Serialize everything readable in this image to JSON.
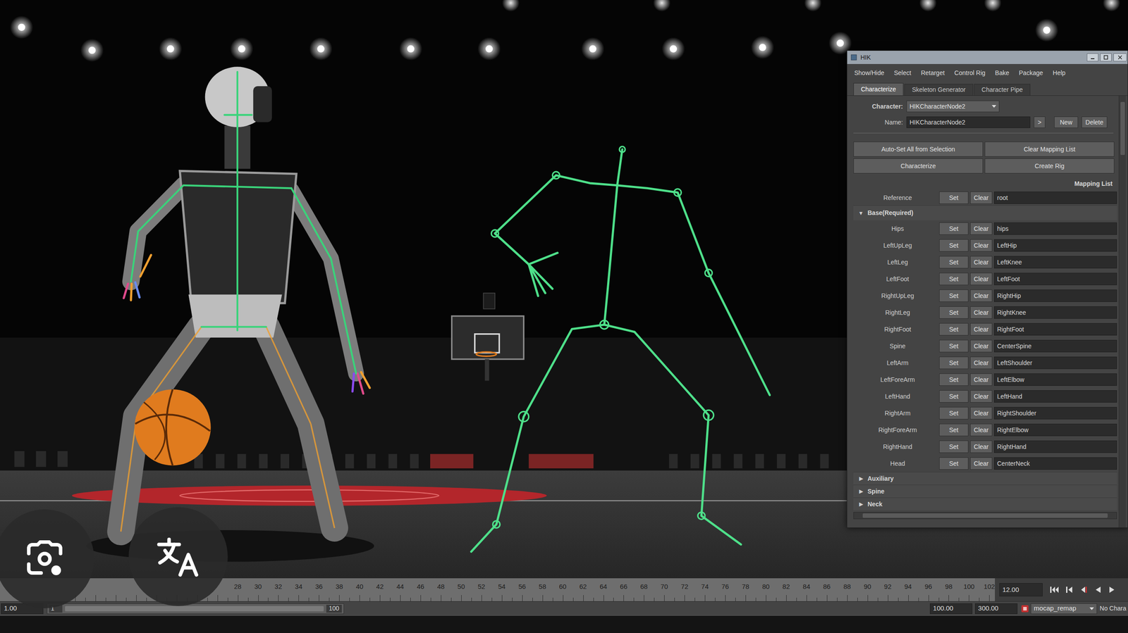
{
  "hik": {
    "title": "HIK",
    "menu": [
      "Show/Hide",
      "Select",
      "Retarget",
      "Control Rig",
      "Bake",
      "Package",
      "Help"
    ],
    "tabs": [
      {
        "label": "Characterize",
        "selected": true
      },
      {
        "label": "Skeleton Generator",
        "selected": false
      },
      {
        "label": "Character Pipe",
        "selected": false
      }
    ],
    "character": {
      "label": "Character:",
      "value": "HIKCharacterNode2"
    },
    "name": {
      "label": "Name:",
      "value": "HIKCharacterNode2",
      "arrow": ">",
      "new": "New",
      "delete": "Delete"
    },
    "actions": [
      "Auto-Set All from Selection",
      "Clear Mapping List",
      "Characterize",
      "Create Rig"
    ],
    "mapping_label": "Mapping List",
    "reference": {
      "label": "Reference",
      "set": "Set",
      "clear": "Clear",
      "value": "root"
    },
    "sections": [
      {
        "icon": "▼",
        "label": "Base(Required)",
        "expanded": true,
        "rows": [
          {
            "label": "Hips",
            "set": "Set",
            "clear": "Clear",
            "value": "hips"
          },
          {
            "label": "LeftUpLeg",
            "set": "Set",
            "clear": "Clear",
            "value": "LeftHip"
          },
          {
            "label": "LeftLeg",
            "set": "Set",
            "clear": "Clear",
            "value": "LeftKnee"
          },
          {
            "label": "LeftFoot",
            "set": "Set",
            "clear": "Clear",
            "value": "LeftFoot"
          },
          {
            "label": "RightUpLeg",
            "set": "Set",
            "clear": "Clear",
            "value": "RightHip"
          },
          {
            "label": "RightLeg",
            "set": "Set",
            "clear": "Clear",
            "value": "RightKnee"
          },
          {
            "label": "RightFoot",
            "set": "Set",
            "clear": "Clear",
            "value": "RightFoot"
          },
          {
            "label": "Spine",
            "set": "Set",
            "clear": "Clear",
            "value": "CenterSpine"
          },
          {
            "label": "LeftArm",
            "set": "Set",
            "clear": "Clear",
            "value": "LeftShoulder"
          },
          {
            "label": "LeftForeArm",
            "set": "Set",
            "clear": "Clear",
            "value": "LeftElbow"
          },
          {
            "label": "LeftHand",
            "set": "Set",
            "clear": "Clear",
            "value": "LeftHand"
          },
          {
            "label": "RightArm",
            "set": "Set",
            "clear": "Clear",
            "value": "RightShoulder"
          },
          {
            "label": "RightForeArm",
            "set": "Set",
            "clear": "Clear",
            "value": "RightElbow"
          },
          {
            "label": "RightHand",
            "set": "Set",
            "clear": "Clear",
            "value": "RightHand"
          },
          {
            "label": "Head",
            "set": "Set",
            "clear": "Clear",
            "value": "CenterNeck"
          }
        ]
      },
      {
        "icon": "▶",
        "label": "Auxiliary",
        "expanded": false,
        "rows": []
      },
      {
        "icon": "▶",
        "label": "Spine",
        "expanded": false,
        "rows": []
      },
      {
        "icon": "▶",
        "label": "Neck",
        "expanded": false,
        "rows": []
      }
    ]
  },
  "timeline": {
    "ticks": [
      "28",
      "30",
      "32",
      "34",
      "36",
      "38",
      "40",
      "42",
      "44",
      "46",
      "48",
      "50",
      "52",
      "54",
      "56",
      "58",
      "60",
      "62",
      "64",
      "66",
      "68",
      "70",
      "72",
      "74",
      "76",
      "78",
      "80",
      "82",
      "84",
      "86",
      "88",
      "90",
      "92",
      "94",
      "96",
      "98",
      "100",
      "102"
    ],
    "current_frame": "12.00"
  },
  "range": {
    "start": "1.00",
    "slider_start": "1",
    "slider_end": "100",
    "playback_end": "100.00",
    "anim_end": "300.00",
    "anim_layer": "mocap_remap",
    "character": "No Chara"
  }
}
